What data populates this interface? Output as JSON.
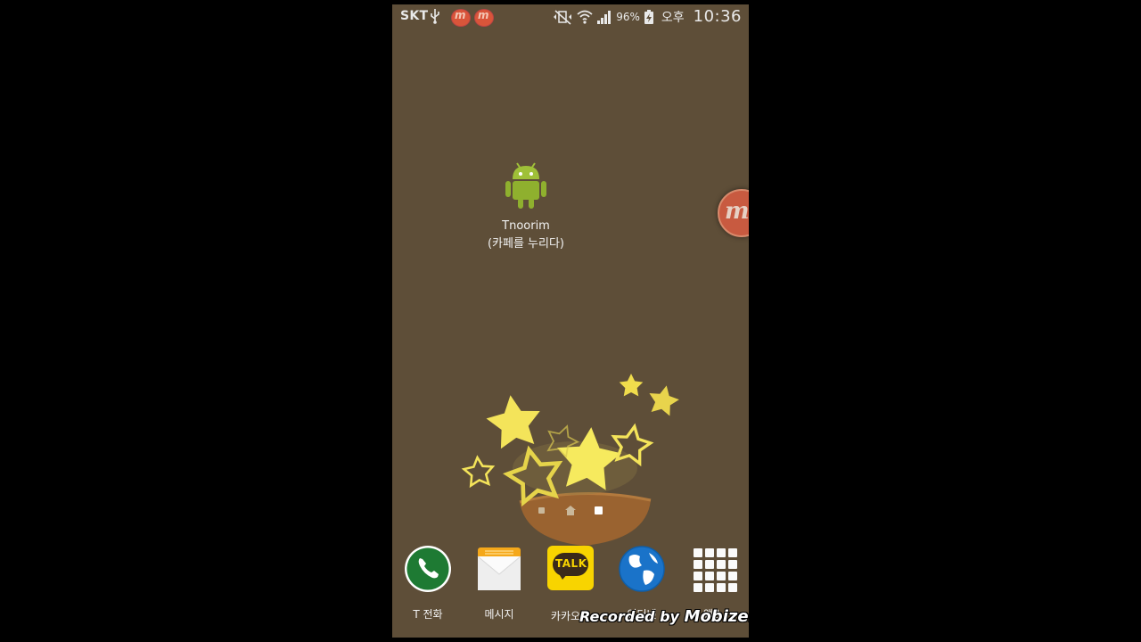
{
  "status_bar": {
    "carrier": "SKT",
    "battery_percent": "96%",
    "ampm": "오후",
    "time": "10:36",
    "icons": [
      "usb-icon",
      "mobizen-icon",
      "mobizen-icon",
      "mute-vibrate-icon",
      "wifi-icon",
      "signal-icon",
      "battery-charging-icon"
    ]
  },
  "desktop": {
    "shortcut": {
      "icon": "android-icon",
      "label_line1": "Tnoorim",
      "label_line2": "(카페를 누리다)"
    },
    "floating_bubble": {
      "icon": "mobizen-bubble-icon",
      "letter": "m"
    }
  },
  "page_indicator": {
    "pages": 3,
    "active_index": 2
  },
  "dock": {
    "items": [
      {
        "label": "T 전화",
        "icon": "phone-icon"
      },
      {
        "label": "메시지",
        "icon": "messages-icon"
      },
      {
        "label": "카카오톡",
        "icon": "kakaotalk-icon",
        "icon_text": "TALK"
      },
      {
        "label": "인터넷",
        "icon": "globe-icon"
      },
      {
        "label": "앱스",
        "icon": "apps-grid-icon"
      }
    ]
  },
  "watermark": {
    "prefix": "Recorded by ",
    "brand": "Mobizen"
  },
  "colors": {
    "wallpaper": "#5e4e38",
    "star_yellow": "#f4e45a",
    "bowl_brown": "#9a6330",
    "mobizen_red": "#d9553a",
    "kakao_yellow": "#f8d400",
    "phone_green": "#1e7a33"
  }
}
